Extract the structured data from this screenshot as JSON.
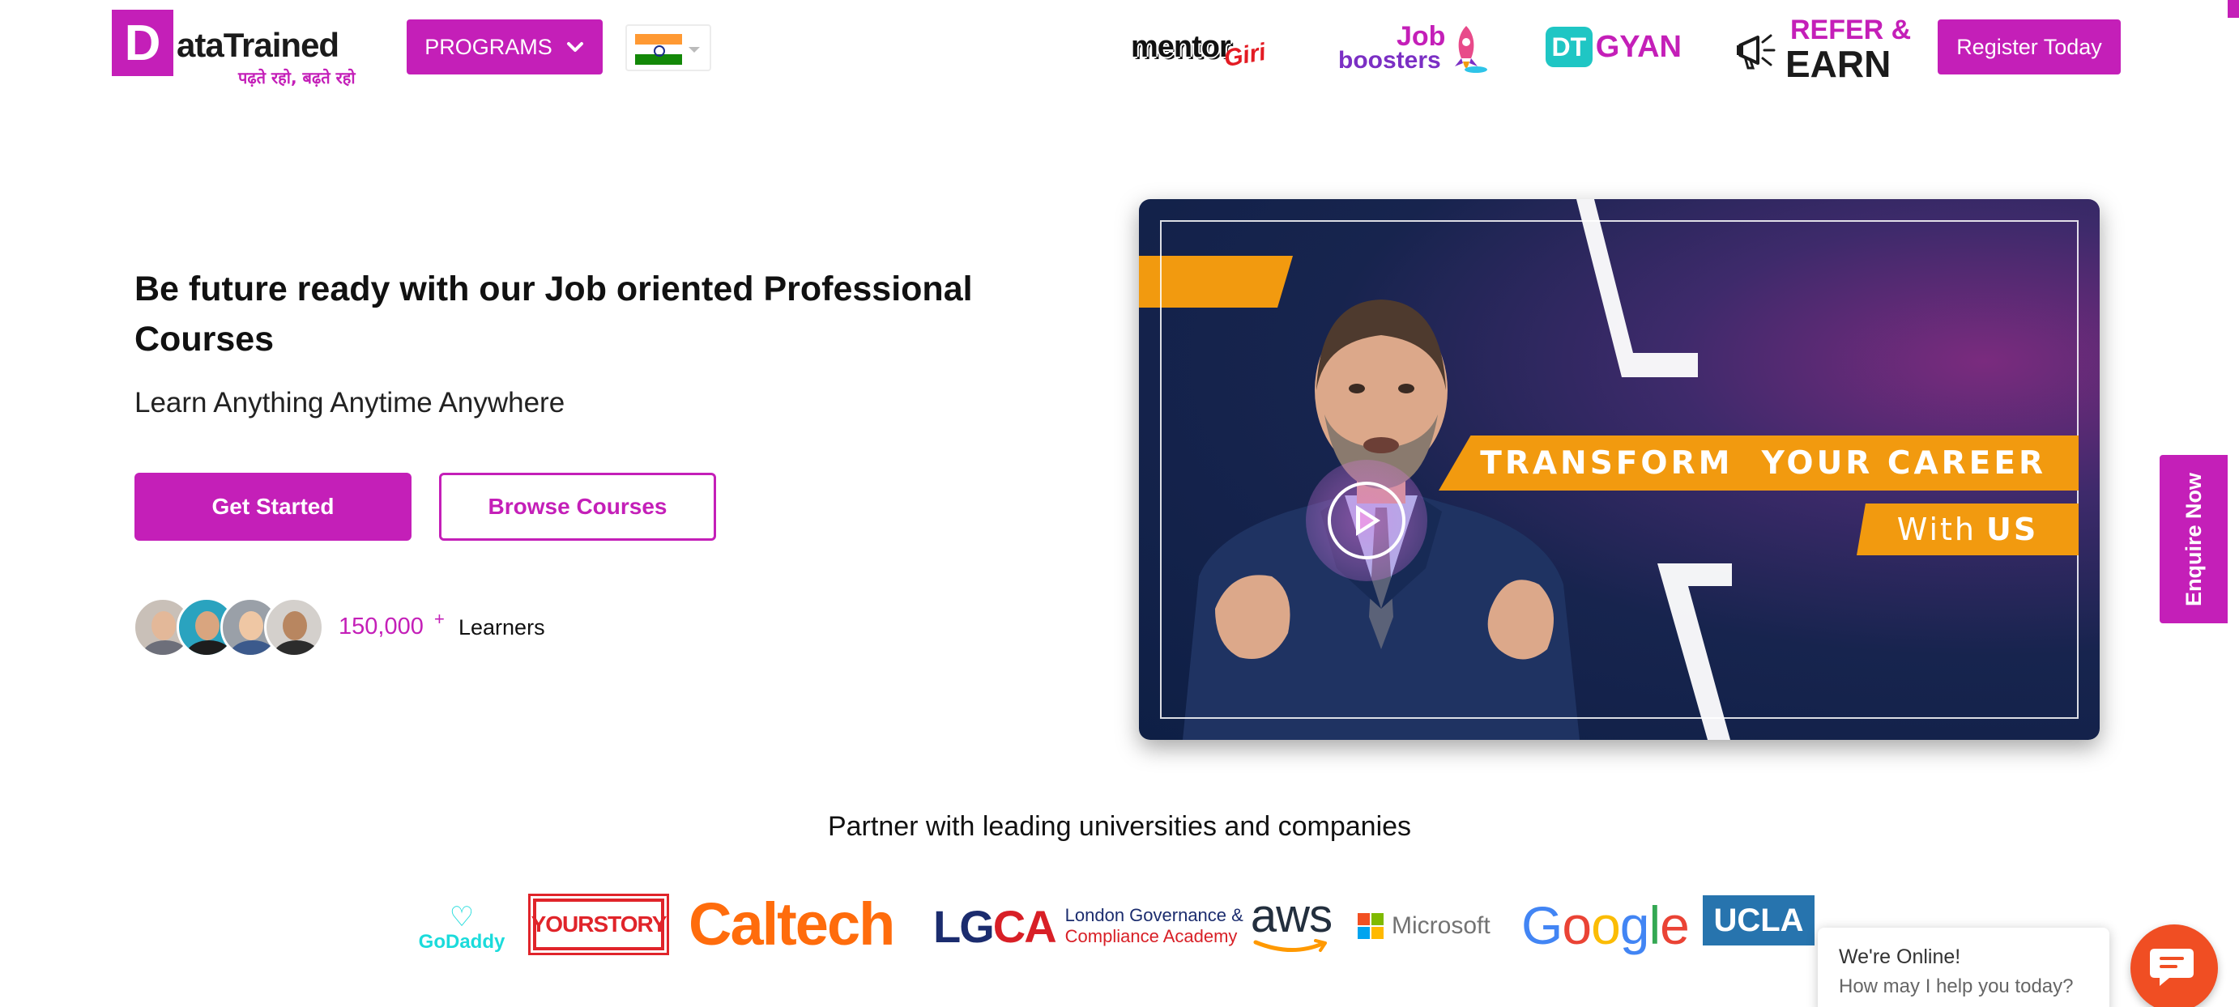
{
  "header": {
    "logo": {
      "letter": "D",
      "word": "ataTrained",
      "tagline": "पढ़ते रहो, बढ़ते रहो"
    },
    "programs_label": "PROGRAMS",
    "country": {
      "flag": "india-flag-icon"
    },
    "brands": {
      "mentorgiri": {
        "part1": "mentor",
        "part2": "Giri"
      },
      "job_boosters": {
        "part1": "Job",
        "part2": "boosters"
      },
      "dt_gyan": {
        "icon_text": "DT",
        "text": "GYAN"
      },
      "refer_earn": {
        "part1": "REFER &",
        "part2": "EARN"
      }
    },
    "register_label": "Register Today"
  },
  "hero": {
    "title": "Be future ready with our Job oriented Professional Courses",
    "subtitle": "Learn Anything Anytime Anywhere",
    "primary_cta": "Get Started",
    "secondary_cta": "Browse Courses",
    "learners": {
      "count": "150,000",
      "plus": "+",
      "label": "Learners"
    }
  },
  "video": {
    "banner_line1": "TRANSFORM  YOUR CAREER",
    "banner_with": "With",
    "banner_us": "US",
    "play_icon": "play-icon"
  },
  "enquire_label": "Enquire Now",
  "partners": {
    "title": "Partner with leading universities and companies",
    "logos": {
      "godaddy": "GoDaddy",
      "yourstory": "YOURSTORY",
      "caltech": "Caltech",
      "lgca_letters_blue": "LG",
      "lgca_letters_red": "CA",
      "lgca_line1": "London Governance &",
      "lgca_line2": "Compliance Academy",
      "aws": "aws",
      "microsoft": "Microsoft",
      "ucla": "UCLA"
    }
  },
  "chat": {
    "status": "We're Online!",
    "prompt": "How may I help you today?"
  },
  "colors": {
    "brand": "#c41fb8",
    "accent_orange": "#f29a0f",
    "chat_button": "#f04e23",
    "video_bg": "#0e1f45"
  }
}
